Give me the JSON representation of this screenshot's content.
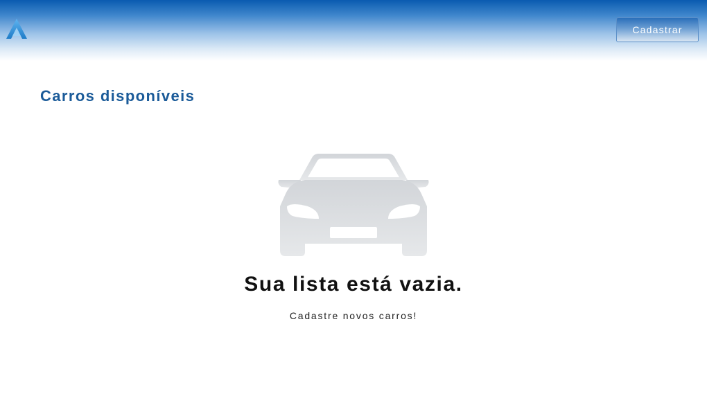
{
  "header": {
    "logo_icon": "logo-icon",
    "register_button_label": "Cadastrar"
  },
  "main": {
    "title": "Carros disponíveis",
    "empty_state": {
      "icon": "car-icon",
      "title": "Sua lista está vazia.",
      "subtitle": "Cadastre novos carros!"
    }
  },
  "colors": {
    "header_top": "#0a5bb0",
    "title": "#1b5b99",
    "car_icon": "#d4d7db"
  }
}
